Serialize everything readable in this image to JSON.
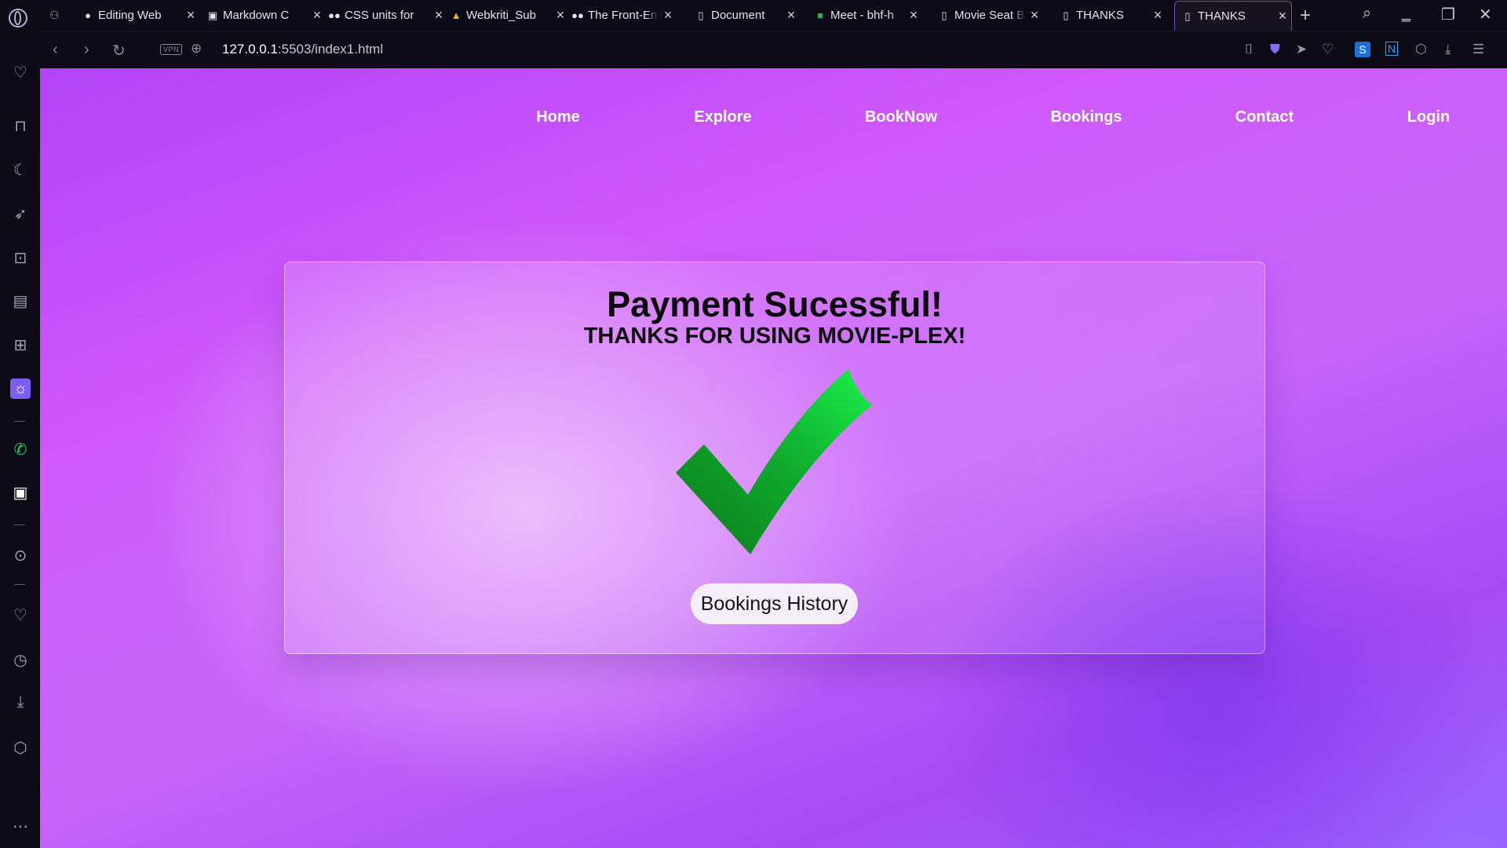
{
  "browser": {
    "tabs": [
      {
        "favicon": "github-icon",
        "title": "Editing Web",
        "active": false
      },
      {
        "favicon": "markdown-icon",
        "title": "Markdown C",
        "active": false
      },
      {
        "favicon": "medium-icon",
        "title": "CSS units for",
        "active": false
      },
      {
        "favicon": "drive-icon",
        "title": "Webkriti_Sub",
        "active": false
      },
      {
        "favicon": "medium-icon",
        "title": "The Front-En",
        "active": false
      },
      {
        "favicon": "document-icon",
        "title": "Document",
        "active": false
      },
      {
        "favicon": "meet-icon",
        "title": "Meet - bhf-h",
        "active": false
      },
      {
        "favicon": "document-icon",
        "title": "Movie Seat B",
        "active": false
      },
      {
        "favicon": "document-icon",
        "title": "THANKS",
        "active": false
      },
      {
        "favicon": "document-icon",
        "title": "THANKS",
        "active": true
      }
    ],
    "address": {
      "vpn_label": "VPN",
      "url_host": "127.0.0.1",
      "url_path": ":5503/index1.html"
    }
  },
  "page": {
    "nav": {
      "home": "Home",
      "explore": "Explore",
      "booknow": "BookNow",
      "bookings": "Bookings",
      "contact": "Contact",
      "login": "Login"
    },
    "card": {
      "title": "Payment Sucessful!",
      "subtitle": "THANKS FOR USING MOVIE-PLEX!",
      "icon": "checkmark-icon",
      "button": "Bookings History"
    }
  },
  "colors": {
    "tabbar_bg": "#0c0b16",
    "accent": "#7d5cf0",
    "check_green": "#16c93c"
  }
}
